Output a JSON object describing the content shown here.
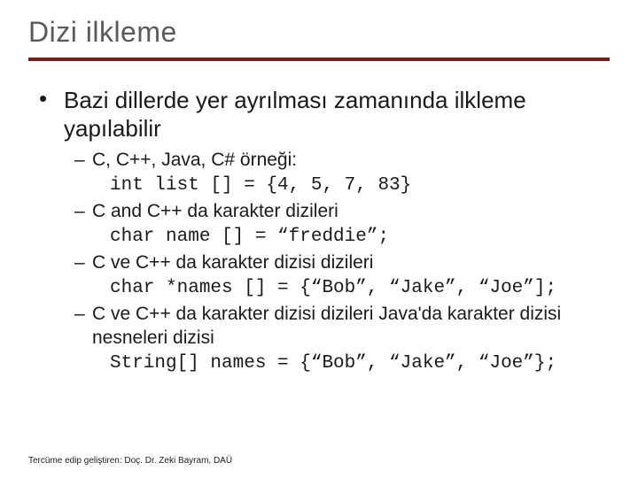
{
  "title": "Dizi ilkleme",
  "bullet": {
    "text": "Bazi dillerde yer ayrılması zamanında ilkleme yapılabilir",
    "items": [
      {
        "dash": "C, C++, Java, C# örneği:",
        "code": "int list [] = {4, 5, 7, 83}"
      },
      {
        "turkish_dash": "C and C++ da karakter dizileri",
        "code": "char name [] = “freddie”;"
      },
      {
        "turkish_dash": "C ve C++ da karakter dizisi dizileri",
        "code": "char *names [] = {“Bob”, “Jake”, “Joe”];"
      },
      {
        "turkish_dash": "C ve C++ da karakter dizisi dizileri Java'da karakter dizisi nesneleri dizisi",
        "code": "String[] names = {“Bob”, “Jake”, “Joe”};"
      }
    ]
  },
  "footer": "Tercüme edip geliştiren: Doç. Dr. Zeki Bayram, DAÜ"
}
